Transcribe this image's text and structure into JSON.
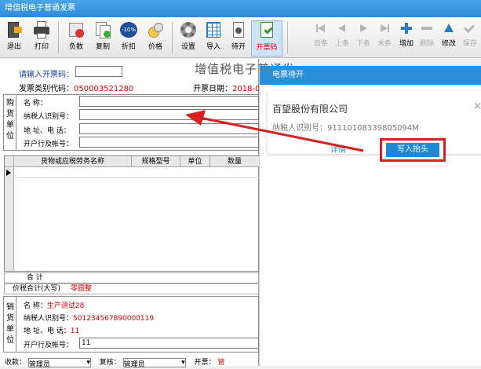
{
  "window": {
    "title": "增值税电子普通发票"
  },
  "toolbar": {
    "left": [
      "退出",
      "打印",
      "负数",
      "复制",
      "折扣",
      "价格",
      "设置",
      "导入",
      "待开",
      "开票码"
    ],
    "right": [
      "首条",
      "上条",
      "下条",
      "末条",
      "增加",
      "删除",
      "修改",
      "保存"
    ],
    "discount_badge": "-10%"
  },
  "header": {
    "code_prompt": "请输入开票码：",
    "type_code_label": "发票类别代码：",
    "type_code_value": "050003521280",
    "date_label": "开票日期：",
    "date_value": "2018-0",
    "stamp_text": "增值税电子普通发"
  },
  "buyer": {
    "side_label": "购货单位",
    "name_label": "名      称：",
    "taxid_label": "纳税人识别号：",
    "addr_label": "地 址、电 话：",
    "bank_label": "开户行及帐号："
  },
  "grid": {
    "columns": [
      "货物或应税劳务名称",
      "规格型号",
      "单位",
      "数量"
    ]
  },
  "totals": {
    "sum_label": "合      计",
    "total_label": "价税合计(大写)",
    "total_value": "零圆整"
  },
  "seller": {
    "side_label": "销货单位",
    "name_label": "名      称：",
    "name_value": "生产测试28",
    "taxid_label": "纳税人识别号：",
    "taxid_value": "501234567890000119",
    "addr_label": "地 址、电 话：",
    "addr_value": "11",
    "bank_label": "开户行及帐号：",
    "bank_value": "11"
  },
  "footer": {
    "payee_label": "收款：",
    "payee_value": "管理员",
    "reviewer_label": "复核：",
    "reviewer_value": "管理员",
    "issuer_label": "开票：",
    "issuer_value": "管"
  },
  "overlay": {
    "title": "电票待开",
    "company": "百望股份有限公司",
    "close": "×",
    "taxid_label": "纳税人识别号：",
    "taxid_value": "91110108339805094M",
    "detail_link": "详情",
    "write_button": "写入抬头"
  },
  "colors": {
    "accent": "#2b8fd8",
    "highlight": "#d72020",
    "link": "#1a3ea8"
  }
}
